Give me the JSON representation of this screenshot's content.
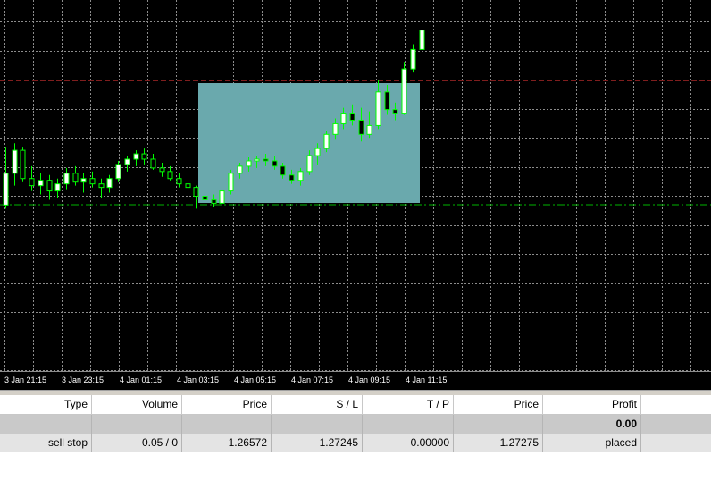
{
  "chart": {
    "colors": {
      "background": "#000000",
      "grid": "#8c8c8c",
      "candle": "#00ff00",
      "bull_body": "#ffffff",
      "bear_body": "#000000",
      "highlight": "#6aa9ad",
      "ask_line": "#ff3c3c",
      "order_line": "#00b400",
      "axis_text": "#ffffff"
    },
    "time_labels": [
      "3 Jan 21:15",
      "3 Jan 23:15",
      "4 Jan 01:15",
      "4 Jan 03:15",
      "4 Jan 05:15",
      "4 Jan 07:15",
      "4 Jan 09:15",
      "4 Jan 11:15"
    ],
    "order_line_price": 1.26572,
    "ask_line_price": 1.27275,
    "candles": [
      [
        1.2657,
        1.269,
        1.2655,
        1.2675
      ],
      [
        1.2675,
        1.2692,
        1.2668,
        1.2688
      ],
      [
        1.2688,
        1.269,
        1.267,
        1.2672
      ],
      [
        1.2672,
        1.2679,
        1.2665,
        1.2668
      ],
      [
        1.2668,
        1.2675,
        1.2663,
        1.2671
      ],
      [
        1.2671,
        1.2674,
        1.266,
        1.2665
      ],
      [
        1.2665,
        1.2672,
        1.2661,
        1.2669
      ],
      [
        1.2669,
        1.2678,
        1.2666,
        1.2675
      ],
      [
        1.2675,
        1.2679,
        1.2668,
        1.267
      ],
      [
        1.267,
        1.2675,
        1.2664,
        1.2672
      ],
      [
        1.2672,
        1.2676,
        1.2667,
        1.2669
      ],
      [
        1.2669,
        1.2672,
        1.2661,
        1.2667
      ],
      [
        1.2667,
        1.2674,
        1.2664,
        1.2672
      ],
      [
        1.2672,
        1.2682,
        1.267,
        1.268
      ],
      [
        1.268,
        1.2685,
        1.2676,
        1.2683
      ],
      [
        1.2683,
        1.2688,
        1.2679,
        1.2686
      ],
      [
        1.2686,
        1.2689,
        1.268,
        1.2683
      ],
      [
        1.2683,
        1.2686,
        1.2677,
        1.2678
      ],
      [
        1.2678,
        1.2681,
        1.2673,
        1.2676
      ],
      [
        1.2676,
        1.2679,
        1.2671,
        1.2672
      ],
      [
        1.2672,
        1.2675,
        1.2667,
        1.2669
      ],
      [
        1.2669,
        1.2672,
        1.2664,
        1.2667
      ],
      [
        1.2667,
        1.2668,
        1.2655,
        1.2662
      ],
      [
        1.2662,
        1.2665,
        1.2656,
        1.266
      ],
      [
        1.266,
        1.2663,
        1.2656,
        1.2658
      ],
      [
        1.2658,
        1.2667,
        1.2657,
        1.2665
      ],
      [
        1.2665,
        1.2677,
        1.2663,
        1.2675
      ],
      [
        1.2675,
        1.2681,
        1.2672,
        1.2679
      ],
      [
        1.2679,
        1.2684,
        1.2676,
        1.2682
      ],
      [
        1.2682,
        1.2685,
        1.2678,
        1.2683
      ],
      [
        1.2683,
        1.2686,
        1.2679,
        1.2682
      ],
      [
        1.2682,
        1.2685,
        1.2677,
        1.2679
      ],
      [
        1.2679,
        1.2681,
        1.2672,
        1.2674
      ],
      [
        1.2674,
        1.2677,
        1.2669,
        1.2671
      ],
      [
        1.2671,
        1.2678,
        1.2668,
        1.2676
      ],
      [
        1.2676,
        1.2688,
        1.2674,
        1.2685
      ],
      [
        1.2685,
        1.2692,
        1.268,
        1.2689
      ],
      [
        1.2689,
        1.2699,
        1.2687,
        1.2697
      ],
      [
        1.2697,
        1.2706,
        1.2694,
        1.2703
      ],
      [
        1.2703,
        1.2712,
        1.27,
        1.2709
      ],
      [
        1.2709,
        1.2714,
        1.2702,
        1.2705
      ],
      [
        1.2705,
        1.2712,
        1.2693,
        1.2697
      ],
      [
        1.2697,
        1.271,
        1.2695,
        1.2702
      ],
      [
        1.2702,
        1.2728,
        1.27,
        1.2721
      ],
      [
        1.2721,
        1.2725,
        1.2708,
        1.2711
      ],
      [
        1.2711,
        1.2715,
        1.2705,
        1.2709
      ],
      [
        1.2709,
        1.2738,
        1.2708,
        1.2734
      ],
      [
        1.2734,
        1.2748,
        1.2732,
        1.2745
      ],
      [
        1.2745,
        1.2759,
        1.2743,
        1.2756
      ]
    ]
  },
  "orders": {
    "headers": {
      "type": "Type",
      "volume": "Volume",
      "price": "Price",
      "sl": "S / L",
      "tp": "T / P",
      "price2": "Price",
      "profit": "Profit"
    },
    "balance_profit": "0.00",
    "rows": [
      {
        "type": "sell stop",
        "volume": "0.05 / 0",
        "price": "1.26572",
        "sl": "1.27245",
        "tp": "0.00000",
        "price2": "1.27275",
        "profit": "placed"
      }
    ]
  }
}
